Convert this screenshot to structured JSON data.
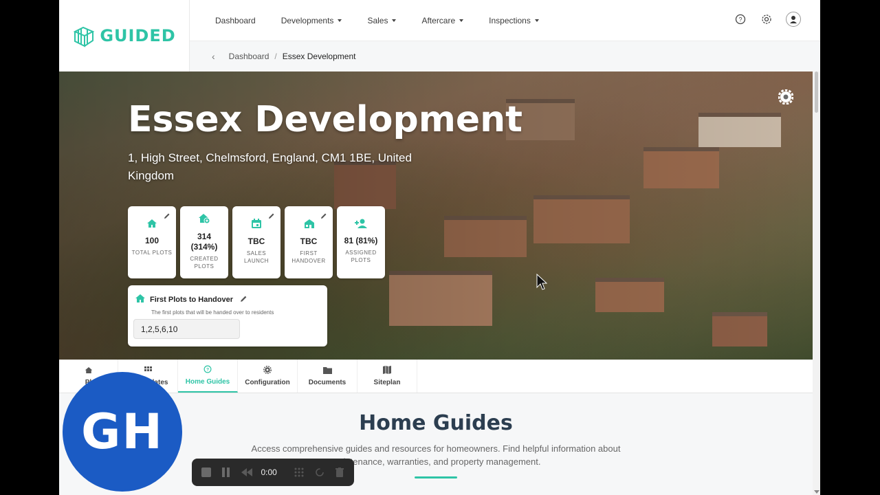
{
  "brand": {
    "name": "GUIDED",
    "color": "#2ec4a6"
  },
  "nav": {
    "items": [
      {
        "label": "Dashboard",
        "dropdown": false
      },
      {
        "label": "Developments",
        "dropdown": true
      },
      {
        "label": "Sales",
        "dropdown": true
      },
      {
        "label": "Aftercare",
        "dropdown": true
      },
      {
        "label": "Inspections",
        "dropdown": true
      }
    ],
    "icons": [
      "help-icon",
      "gear-icon",
      "user-avatar"
    ]
  },
  "breadcrumb": {
    "parent": "Dashboard",
    "separator": "/",
    "current": "Essex Development"
  },
  "hero": {
    "title": "Essex Development",
    "address": "1, High Street, Chelmsford, England, CM1 1BE, United Kingdom"
  },
  "stats": [
    {
      "icon": "home-icon",
      "value": "100",
      "label": "TOTAL PLOTS",
      "editable": true
    },
    {
      "icon": "home-add-icon",
      "value": "314 (314%)",
      "label": "CREATED PLOTS",
      "editable": false
    },
    {
      "icon": "calendar-icon",
      "value": "TBC",
      "label": "SALES LAUNCH",
      "editable": true
    },
    {
      "icon": "handover-icon",
      "value": "TBC",
      "label": "FIRST HANDOVER",
      "editable": true
    },
    {
      "icon": "person-add-icon",
      "value": "81 (81%)",
      "label": "ASSIGNED PLOTS",
      "editable": false
    }
  ],
  "handover": {
    "title": "First Plots to Handover",
    "subtitle": "The first plots that will be handed over to residents",
    "value": "1,2,5,6,10"
  },
  "tabs": [
    {
      "label": "Pl",
      "icon": "home-icon",
      "active": false
    },
    {
      "label": "plates",
      "icon": "grid-icon",
      "active": false
    },
    {
      "label": "Home Guides",
      "icon": "help-icon",
      "active": true
    },
    {
      "label": "Configuration",
      "icon": "gear-icon",
      "active": false
    },
    {
      "label": "Documents",
      "icon": "folder-icon",
      "active": false
    },
    {
      "label": "Siteplan",
      "icon": "map-icon",
      "active": false
    }
  ],
  "section": {
    "title": "Home Guides",
    "description": "Access comprehensive guides and resources for homeowners. Find helpful information about maintenance, warranties, and property management."
  },
  "overlay": {
    "badge_initials": "GH",
    "recorder_time": "0:00"
  }
}
